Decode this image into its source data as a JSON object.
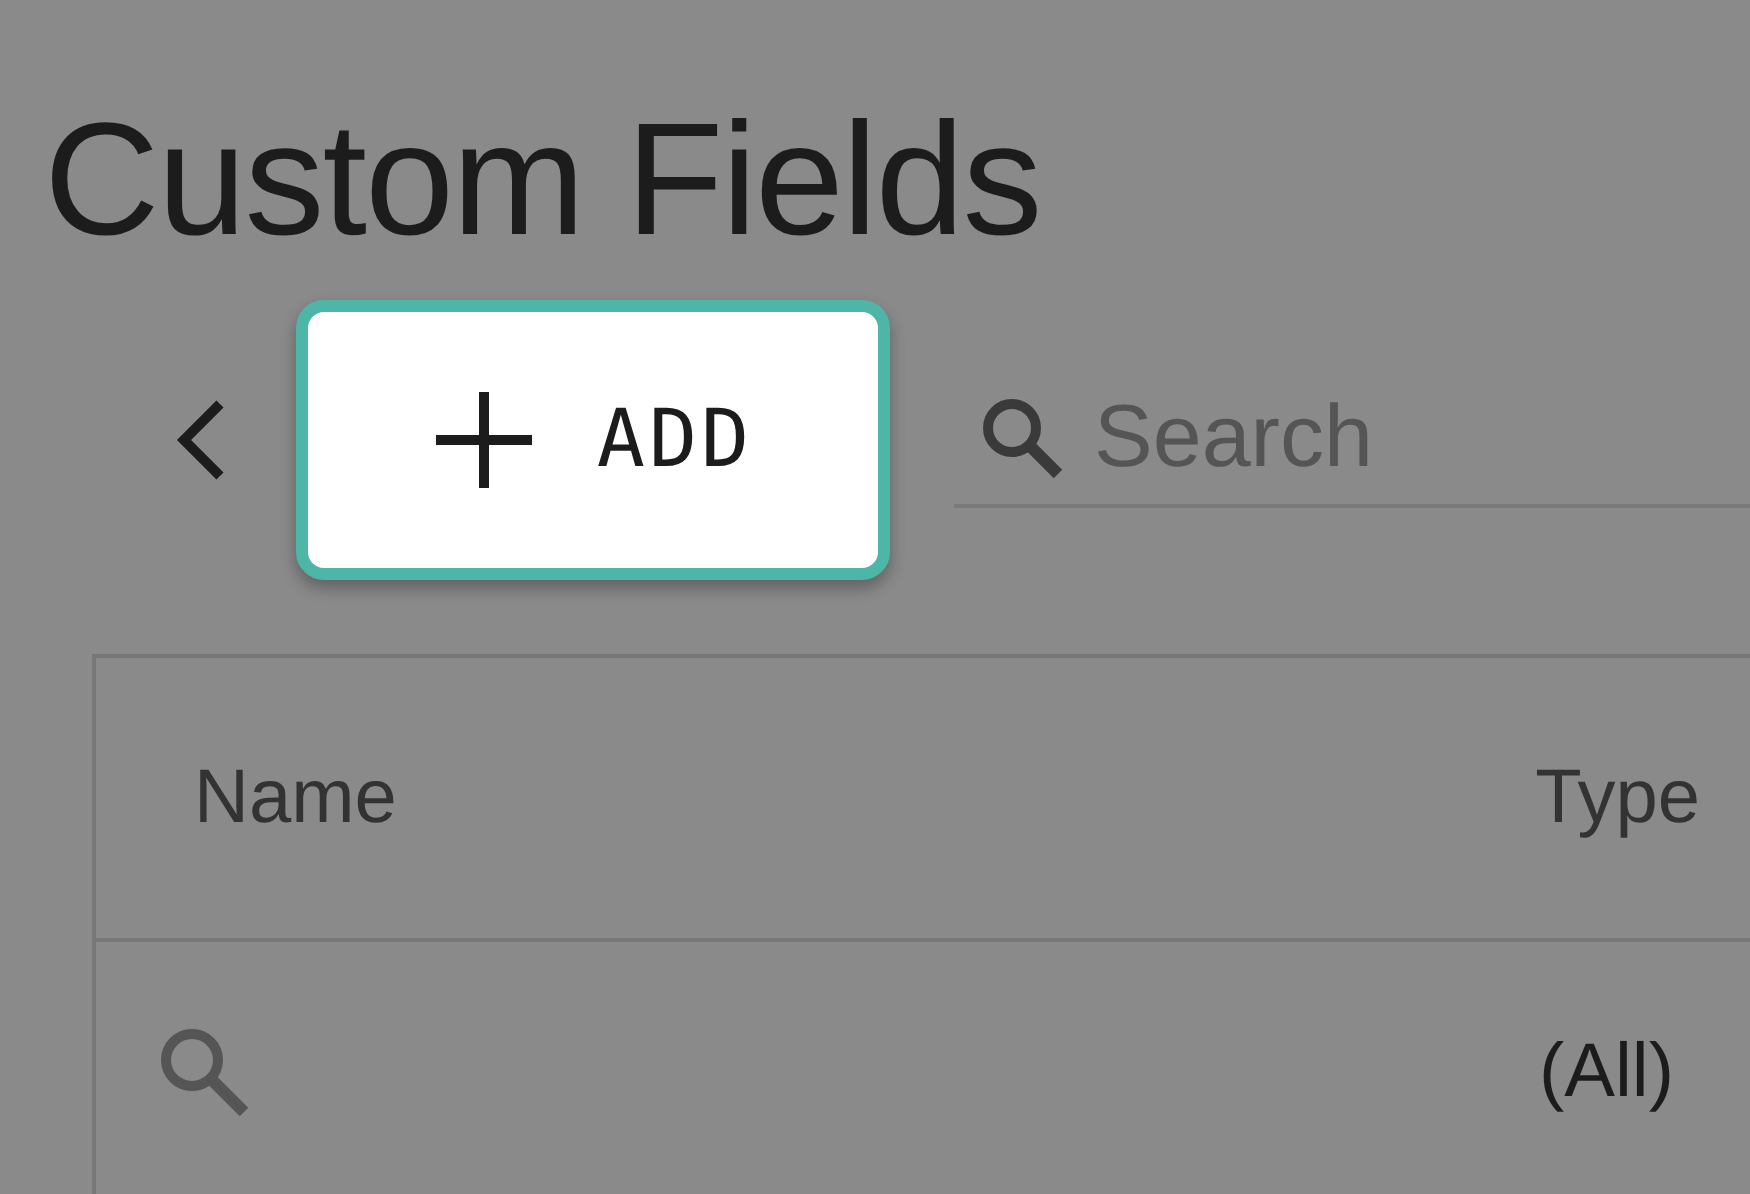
{
  "page": {
    "title": "Custom Fields"
  },
  "toolbar": {
    "add_button": {
      "label": "ADD",
      "highlighted": true
    },
    "search": {
      "placeholder": "Search"
    }
  },
  "table": {
    "columns": [
      {
        "label": "Name"
      },
      {
        "label": "Type"
      }
    ],
    "filter_row": {
      "type_filter": "(All)"
    }
  }
}
